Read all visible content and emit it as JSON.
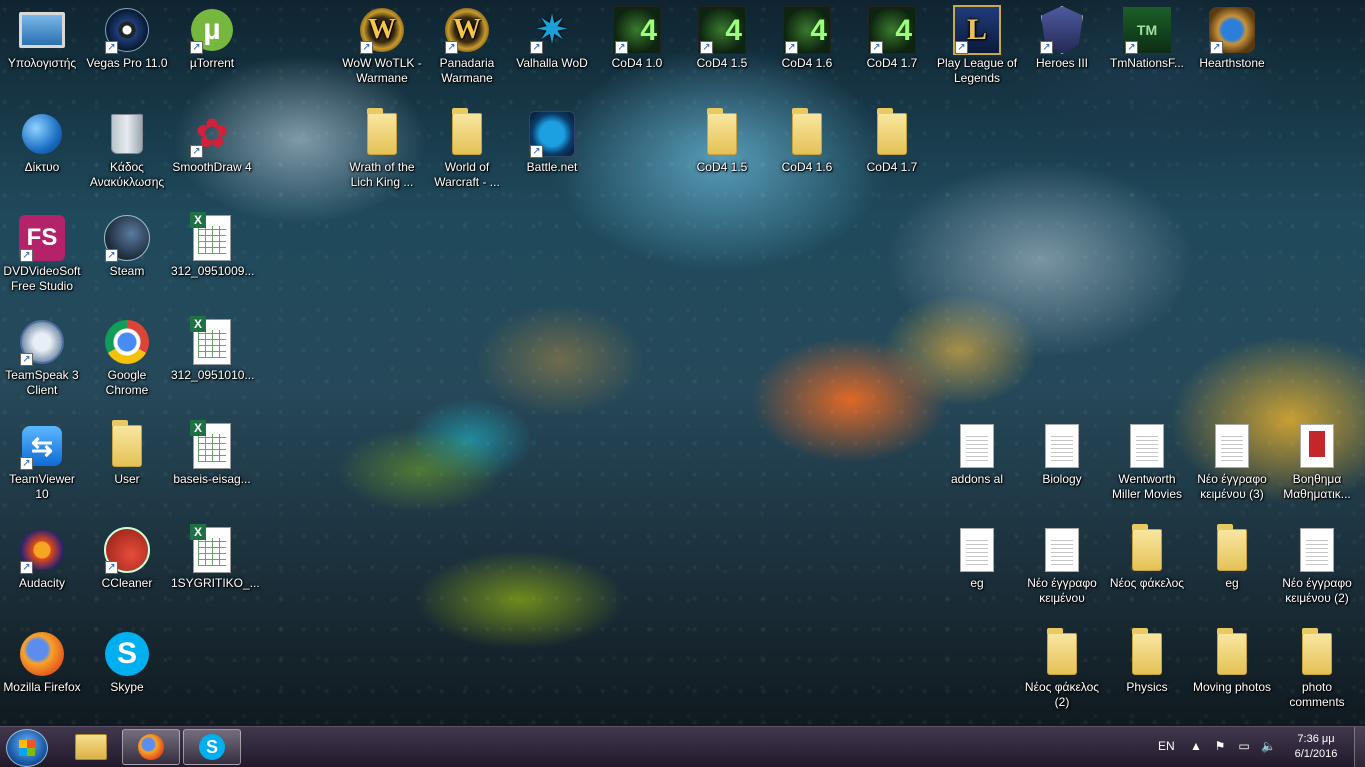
{
  "desktop": {
    "icons": [
      {
        "label": "Υπολογιστής",
        "icon": "computer-icon"
      },
      {
        "label": "Vegas Pro 11.0",
        "icon": "vegas-pro-icon"
      },
      {
        "label": "µTorrent",
        "icon": "utorrent-icon"
      },
      {
        "label": "WoW WoTLK - Warmane",
        "icon": "wow-icon"
      },
      {
        "label": "Panadaria Warmane",
        "icon": "wow-icon"
      },
      {
        "label": "Valhalla WoD",
        "icon": "valhalla-icon"
      },
      {
        "label": "CoD4 1.0",
        "icon": "cod4-icon"
      },
      {
        "label": "CoD4 1.5",
        "icon": "cod4-icon"
      },
      {
        "label": "CoD4 1.6",
        "icon": "cod4-icon"
      },
      {
        "label": "CoD4 1.7",
        "icon": "cod4-icon"
      },
      {
        "label": "Play League of Legends",
        "icon": "league-of-legends-icon"
      },
      {
        "label": "Heroes III",
        "icon": "heroes-iii-icon"
      },
      {
        "label": "TmNationsF...",
        "icon": "tmnations-icon"
      },
      {
        "label": "Hearthstone",
        "icon": "hearthstone-icon"
      },
      {
        "label": "Δίκτυο",
        "icon": "network-globe-icon"
      },
      {
        "label": "Κάδος Ανακύκλωσης",
        "icon": "recycle-bin-icon"
      },
      {
        "label": "SmoothDraw 4",
        "icon": "smoothdraw-icon"
      },
      {
        "label": "Wrath of the Lich King ...",
        "icon": "folder-icon"
      },
      {
        "label": "World of Warcraft - ...",
        "icon": "folder-icon"
      },
      {
        "label": "Battle.net",
        "icon": "battlenet-icon"
      },
      {
        "label": "CoD4 1.5",
        "icon": "folder-icon"
      },
      {
        "label": "CoD4 1.6",
        "icon": "folder-icon"
      },
      {
        "label": "CoD4 1.7",
        "icon": "folder-icon"
      },
      {
        "label": "DVDVideoSoft Free Studio",
        "icon": "dvdvideosoft-icon"
      },
      {
        "label": "Steam",
        "icon": "steam-icon"
      },
      {
        "label": "312_0951009...",
        "icon": "excel-file-icon"
      },
      {
        "label": "TeamSpeak 3 Client",
        "icon": "teamspeak-icon"
      },
      {
        "label": "Google Chrome",
        "icon": "chrome-icon"
      },
      {
        "label": "312_0951010...",
        "icon": "excel-file-icon"
      },
      {
        "label": "TeamViewer 10",
        "icon": "teamviewer-icon"
      },
      {
        "label": "User",
        "icon": "user-folder-icon"
      },
      {
        "label": "baseis-eisag...",
        "icon": "excel-file-icon"
      },
      {
        "label": "addons al",
        "icon": "text-file-icon"
      },
      {
        "label": "Biology",
        "icon": "text-file-icon"
      },
      {
        "label": "Wentworth Miller Movies",
        "icon": "text-file-icon"
      },
      {
        "label": "Νέο έγγραφο κειμένου (3)",
        "icon": "text-file-icon"
      },
      {
        "label": "Βοηθημα Μαθηματικ...",
        "icon": "pdf-file-icon"
      },
      {
        "label": "Audacity",
        "icon": "audacity-icon"
      },
      {
        "label": "CCleaner",
        "icon": "ccleaner-icon"
      },
      {
        "label": "1SYGRITIKO_...",
        "icon": "excel-file-icon"
      },
      {
        "label": "eg",
        "icon": "text-file-icon"
      },
      {
        "label": "Νέο έγγραφο κειμένου",
        "icon": "text-file-icon"
      },
      {
        "label": "Νέος φάκελος",
        "icon": "folder-icon"
      },
      {
        "label": "eg",
        "icon": "folder-icon"
      },
      {
        "label": "Νέο έγγραφο κειμένου (2)",
        "icon": "text-file-icon"
      },
      {
        "label": "Mozilla Firefox",
        "icon": "firefox-icon"
      },
      {
        "label": "Skype",
        "icon": "skype-icon"
      },
      {
        "label": "Νέος φάκελος (2)",
        "icon": "folder-icon"
      },
      {
        "label": "Physics",
        "icon": "folder-icon"
      },
      {
        "label": "Moving photos",
        "icon": "folder-icon"
      },
      {
        "label": "photo comments",
        "icon": "folder-icon"
      }
    ]
  },
  "taskbar": {
    "pinned": [
      {
        "name": "windows-explorer-icon"
      },
      {
        "name": "firefox-icon"
      },
      {
        "name": "skype-icon"
      }
    ],
    "language": "EN",
    "time": "7:36 μμ",
    "date": "6/1/2016"
  }
}
